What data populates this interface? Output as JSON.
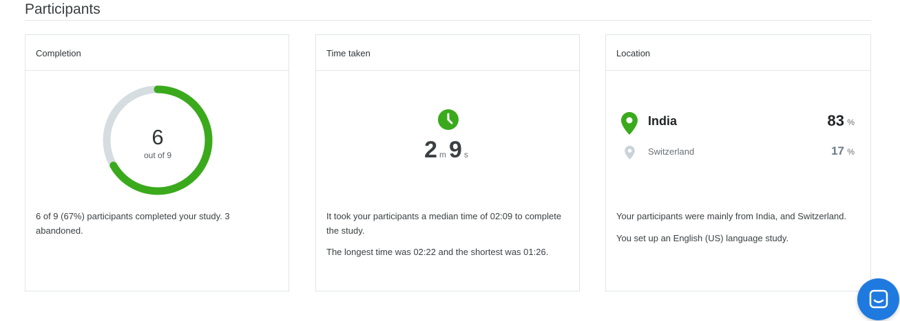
{
  "section": {
    "title": "Participants"
  },
  "completion": {
    "header": "Completion",
    "completed": "6",
    "out_of": "out of 9",
    "fraction": 0.667,
    "description": "6 of 9 (67%) participants completed your study. 3 abandoned.",
    "ring_color": "#3aaa1c",
    "track_color": "#d5dde0"
  },
  "time_taken": {
    "header": "Time taken",
    "minutes": "2",
    "minutes_unit": "m",
    "seconds": "9",
    "seconds_unit": "s",
    "icon": "clock-icon",
    "description_1": "It took your participants a median time of 02:09 to complete the study.",
    "description_2": "The longest time was 02:22 and the shortest was 01:26."
  },
  "location": {
    "header": "Location",
    "primary": {
      "name": "India",
      "value": "83",
      "unit": "%"
    },
    "secondary": {
      "name": "Switzerland",
      "value": "17",
      "unit": "%"
    },
    "pin_color": "#3aaa1c",
    "pin_muted_color": "#c9d3d8",
    "description_1": "Your participants were mainly from India, and Switzerland.",
    "description_2": "You set up an English (US) language study."
  },
  "chat": {
    "icon": "chat-icon",
    "color": "#1f7ae0"
  }
}
